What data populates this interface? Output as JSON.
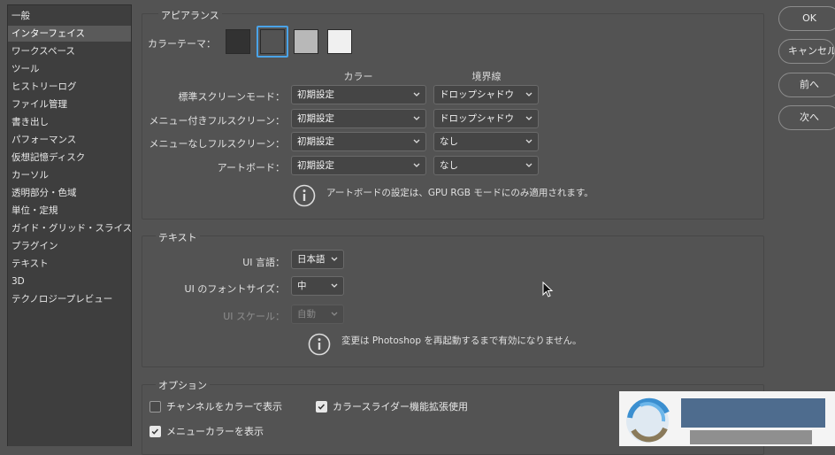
{
  "sidebar": {
    "items": [
      {
        "label": "一般"
      },
      {
        "label": "インターフェイス",
        "selected": true
      },
      {
        "label": "ワークスペース"
      },
      {
        "label": "ツール"
      },
      {
        "label": "ヒストリーログ"
      },
      {
        "label": "ファイル管理"
      },
      {
        "label": "書き出し"
      },
      {
        "label": "パフォーマンス"
      },
      {
        "label": "仮想記憶ディスク"
      },
      {
        "label": "カーソル"
      },
      {
        "label": "透明部分・色域"
      },
      {
        "label": "単位・定規"
      },
      {
        "label": "ガイド・グリッド・スライス"
      },
      {
        "label": "プラグイン"
      },
      {
        "label": "テキスト"
      },
      {
        "label": "3D"
      },
      {
        "label": "テクノロジープレビュー"
      }
    ]
  },
  "appearance": {
    "title": "アピアランス",
    "theme_label": "カラーテーマ：",
    "swatch_colors": [
      "#323232",
      "#535353",
      "#b8b8b8",
      "#f0f0f0"
    ],
    "selected_swatch": 1,
    "col_color": "カラー",
    "col_border": "境界線",
    "rows": [
      {
        "label": "標準スクリーンモード：",
        "color": "初期設定",
        "border": "ドロップシャドウ"
      },
      {
        "label": "メニュー付きフルスクリーン：",
        "color": "初期設定",
        "border": "ドロップシャドウ"
      },
      {
        "label": "メニューなしフルスクリーン：",
        "color": "初期設定",
        "border": "なし"
      },
      {
        "label": "アートボード：",
        "color": "初期設定",
        "border": "なし"
      }
    ],
    "note": "アートボードの設定は、GPU RGB モードにのみ適用されます。"
  },
  "text_section": {
    "title": "テキスト",
    "ui_language_label": "UI 言語：",
    "ui_language_value": "日本語",
    "font_size_label": "UI のフォントサイズ：",
    "font_size_value": "中",
    "ui_scale_label": "UI スケール：",
    "ui_scale_value": "自動",
    "note": "変更は Photoshop を再起動するまで有効になりません。"
  },
  "options": {
    "title": "オプション",
    "channels_in_color": {
      "label": "チャンネルをカラーで表示",
      "checked": false
    },
    "dynamic_sliders": {
      "label": "カラースライダー機能拡張使用",
      "checked": true
    },
    "menu_colors": {
      "label": "メニューカラーを表示",
      "checked": true
    }
  },
  "buttons": {
    "ok": "OK",
    "cancel": "キャンセル",
    "prev": "前へ",
    "next": "次へ"
  },
  "colors": {
    "background": "#535353",
    "sidebar_bg": "#3e3e3e",
    "selection_ring": "#4aa3e8"
  }
}
